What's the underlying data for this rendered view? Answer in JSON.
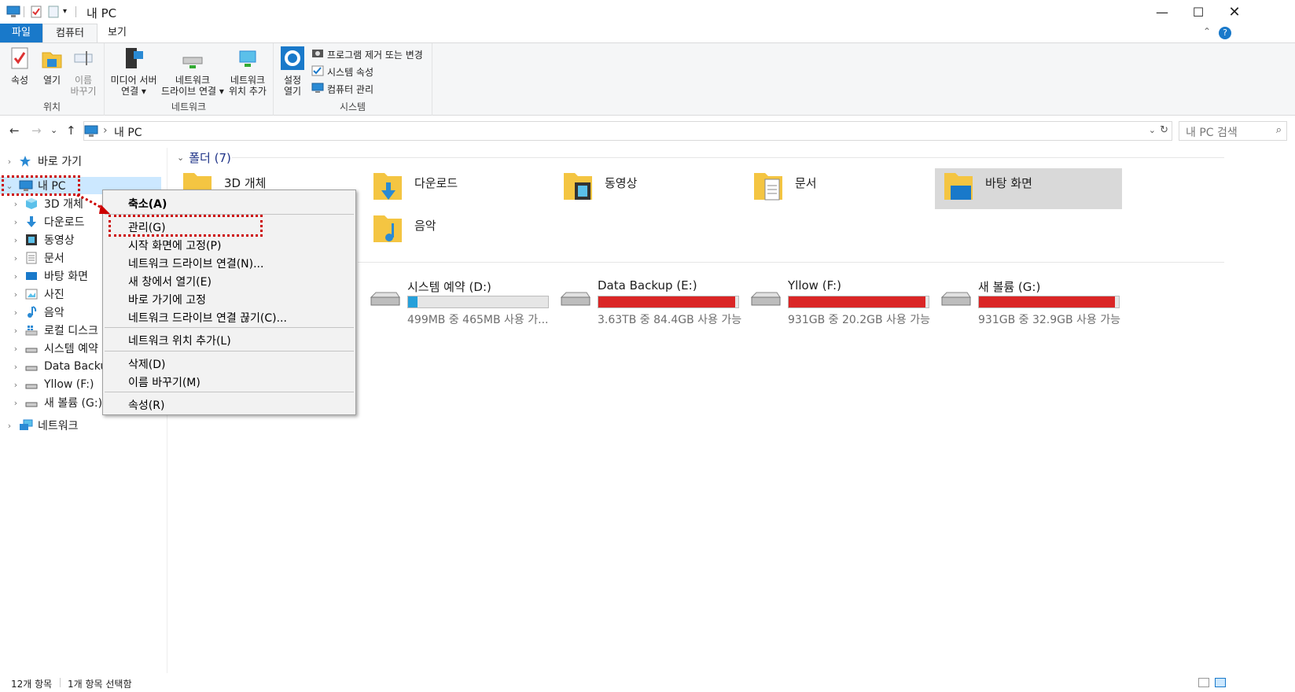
{
  "window": {
    "title": "내 PC",
    "minimize": "—",
    "maximize": "☐",
    "close": "✕"
  },
  "ribbon_tabs": {
    "file": "파일",
    "computer": "컴퓨터",
    "view": "보기"
  },
  "ribbon": {
    "location": {
      "label": "위치",
      "properties": "속성",
      "open": "열기",
      "rename_line1": "이름",
      "rename_line2": "바꾸기"
    },
    "network": {
      "label": "네트워크",
      "media_line1": "미디어 서버",
      "media_line2": "연결 ▾",
      "map_line1": "네트워크",
      "map_line2": "드라이브 연결 ▾",
      "addloc_line1": "네트워크",
      "addloc_line2": "위치 추가"
    },
    "system": {
      "label": "시스템",
      "settings_line1": "설정",
      "settings_line2": "열기",
      "uninstall": "프로그램 제거 또는 변경",
      "sysprops": "시스템 속성",
      "manage": "컴퓨터 관리"
    }
  },
  "address": {
    "back": "←",
    "forward": "→",
    "recent": "⌄",
    "up": "↑",
    "separator": "›",
    "path": "내 PC",
    "search_placeholder": "내 PC 검색"
  },
  "nav": {
    "quick_access": "바로 가기",
    "this_pc": "내 PC",
    "objects3d": "3D 개체",
    "downloads": "다운로드",
    "videos": "동영상",
    "documents": "문서",
    "desktop": "바탕 화면",
    "pictures": "사진",
    "music": "음악",
    "local_disk": "로컬 디스크",
    "system_reserved": "시스템 예약",
    "data_backup": "Data Backup",
    "yllow": "Yllow (F:)",
    "new_volume": "새 볼륨 (G:)",
    "network": "네트워크"
  },
  "content": {
    "folders_header": "폴더 (7)",
    "folders": [
      "3D 개체",
      "다운로드",
      "동영상",
      "문서",
      "바탕 화면",
      "음악"
    ],
    "drives": [
      {
        "name": "시스템 예약 (D:)",
        "info": "499MB 중 465MB 사용 가...",
        "used_fraction": 0.07
      },
      {
        "name": "Data Backup (E:)",
        "info": "3.63TB 중 84.4GB 사용 가능",
        "used_fraction": 0.98
      },
      {
        "name": "Yllow (F:)",
        "info": "931GB 중 20.2GB 사용 가능",
        "used_fraction": 0.98
      },
      {
        "name": "새 볼륨 (G:)",
        "info": "931GB 중 32.9GB 사용 가능",
        "used_fraction": 0.97
      }
    ]
  },
  "context_menu": {
    "collapse": "축소(A)",
    "manage": "관리(G)",
    "pin_start": "시작 화면에 고정(P)",
    "map_drive": "네트워크 드라이브 연결(N)...",
    "open_new_window": "새 창에서 열기(E)",
    "pin_quick": "바로 가기에 고정",
    "disconnect_drive": "네트워크 드라이브 연결 끊기(C)...",
    "add_network_location": "네트워크 위치 추가(L)",
    "delete": "삭제(D)",
    "rename": "이름 바꾸기(M)",
    "properties": "속성(R)"
  },
  "status": {
    "item_count": "12개 항목",
    "selected": "1개 항목 선택함"
  },
  "colors": {
    "accent": "#1979ca",
    "drive_ok": "#26a0da",
    "drive_full": "#da2626",
    "highlight": "#cc0000"
  }
}
